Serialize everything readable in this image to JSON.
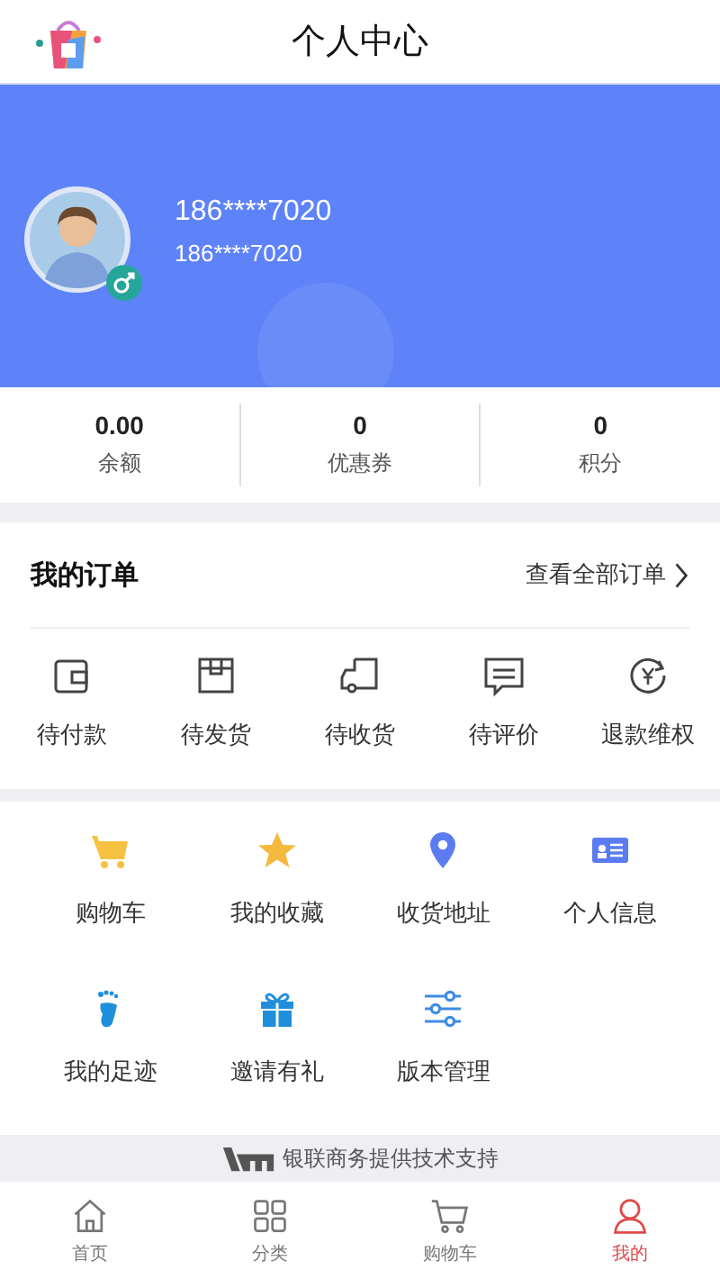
{
  "header": {
    "title": "个人中心"
  },
  "profile": {
    "name": "186****7020",
    "account": "186****7020"
  },
  "stats": [
    {
      "value": "0.00",
      "label": "余额"
    },
    {
      "value": "0",
      "label": "优惠券"
    },
    {
      "value": "0",
      "label": "积分"
    }
  ],
  "orders": {
    "title": "我的订单",
    "view_all": "查看全部订单",
    "items": [
      "待付款",
      "待发货",
      "待收货",
      "待评价",
      "退款维权"
    ]
  },
  "services": [
    "购物车",
    "我的收藏",
    "收货地址",
    "个人信息",
    "我的足迹",
    "邀请有礼",
    "版本管理"
  ],
  "footer": {
    "text": "银联商务提供技术支持"
  },
  "tabs": [
    {
      "label": "首页",
      "selected": false
    },
    {
      "label": "分类",
      "selected": false
    },
    {
      "label": "购物车",
      "selected": false
    },
    {
      "label": "我的",
      "selected": true
    }
  ]
}
